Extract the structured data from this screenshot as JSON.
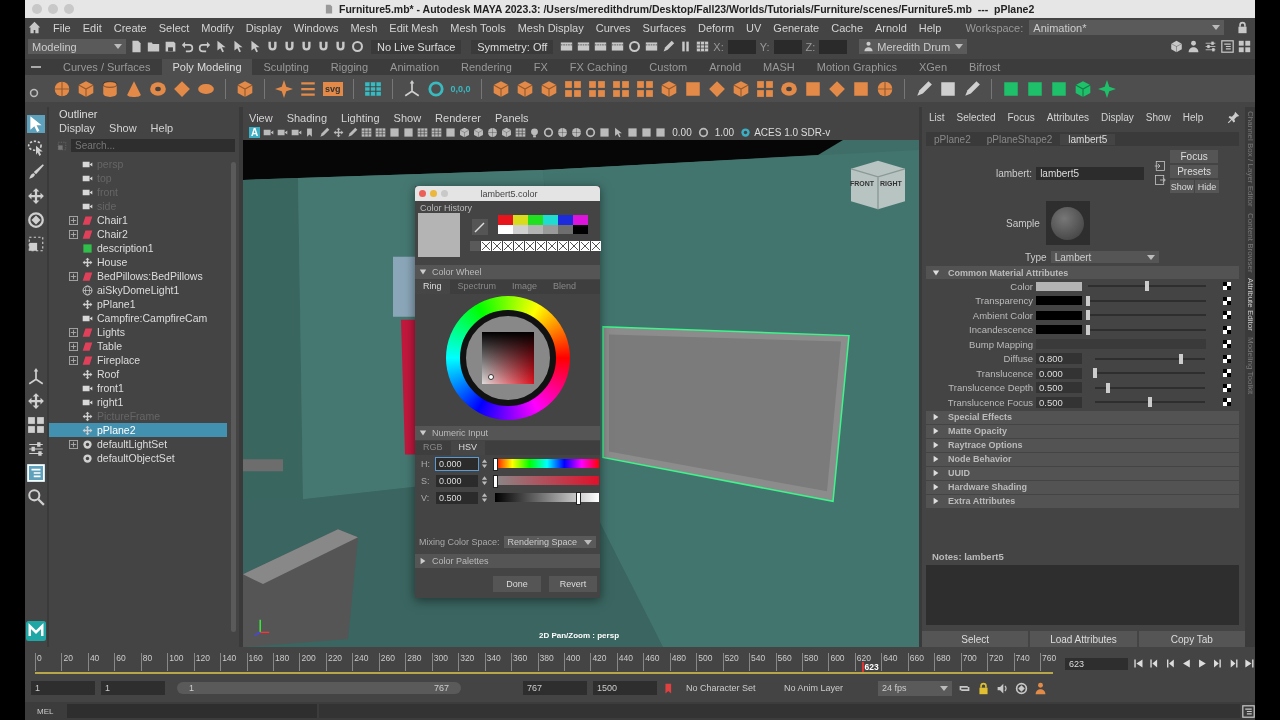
{
  "title_bar": {
    "title": "Furniture5.mb* - Autodesk MAYA 2023.3: /Users/meredithdrum/Desktop/Fall23/Worlds/Tutorials/Furniture/scenes/Furniture5.mb  ---  pPlane2"
  },
  "menu_bar": [
    "File",
    "Edit",
    "Create",
    "Select",
    "Modify",
    "Display",
    "Windows",
    "Mesh",
    "Edit Mesh",
    "Mesh Tools",
    "Mesh Display",
    "Curves",
    "Surfaces",
    "Deform",
    "UV",
    "Generate",
    "Cache",
    "Arnold",
    "Help"
  ],
  "workspace": {
    "label": "Workspace:",
    "value": "Animation*"
  },
  "status_line": {
    "mode": "Modeling",
    "live_surface": "No Live Surface",
    "symmetry": "Symmetry: Off",
    "x_label": "X:",
    "y_label": "Y:",
    "z_label": "Z:",
    "user": "Meredith Drum"
  },
  "shelf_tabs": [
    {
      "label": "Curves / Surfaces",
      "selected": false
    },
    {
      "label": "Poly Modeling",
      "selected": true
    },
    {
      "label": "Sculpting",
      "selected": false
    },
    {
      "label": "Rigging",
      "selected": false
    },
    {
      "label": "Animation",
      "selected": false
    },
    {
      "label": "Rendering",
      "selected": false
    },
    {
      "label": "FX",
      "selected": false
    },
    {
      "label": "FX Caching",
      "selected": false
    },
    {
      "label": "Custom",
      "selected": false
    },
    {
      "label": "Arnold",
      "selected": false
    },
    {
      "label": "MASH",
      "selected": false
    },
    {
      "label": "Motion Graphics",
      "selected": false
    },
    {
      "label": "XGen",
      "selected": false
    },
    {
      "label": "Bifrost",
      "selected": false
    }
  ],
  "shelf": {
    "svg_label": "svg",
    "origin_label": "0,0,0"
  },
  "outliner": {
    "title": "Outliner",
    "menu": [
      "Display",
      "Show",
      "Help"
    ],
    "search": {
      "placeholder": "Search..."
    },
    "items": [
      {
        "name": "persp",
        "kind": "camera",
        "expandable": false,
        "hidden": true,
        "selected": false
      },
      {
        "name": "top",
        "kind": "camera",
        "expandable": false,
        "hidden": true,
        "selected": false
      },
      {
        "name": "front",
        "kind": "camera",
        "expandable": false,
        "hidden": true,
        "selected": false
      },
      {
        "name": "side",
        "kind": "camera",
        "expandable": false,
        "hidden": true,
        "selected": false
      },
      {
        "name": "Chair1",
        "kind": "group",
        "expandable": true,
        "hidden": false,
        "selected": false
      },
      {
        "name": "Chair2",
        "kind": "group",
        "expandable": true,
        "hidden": false,
        "selected": false
      },
      {
        "name": "description1",
        "kind": "xgen",
        "expandable": false,
        "hidden": false,
        "selected": false
      },
      {
        "name": "House",
        "kind": "transform",
        "expandable": false,
        "hidden": false,
        "selected": false
      },
      {
        "name": "BedPillows:BedPillows",
        "kind": "group",
        "expandable": true,
        "hidden": false,
        "selected": false
      },
      {
        "name": "aiSkyDomeLight1",
        "kind": "light",
        "expandable": false,
        "hidden": false,
        "selected": false
      },
      {
        "name": "pPlane1",
        "kind": "transform",
        "expandable": false,
        "hidden": false,
        "selected": false
      },
      {
        "name": "Campfire:CampfireCam",
        "kind": "camera",
        "expandable": false,
        "hidden": false,
        "selected": false
      },
      {
        "name": "Lights",
        "kind": "group",
        "expandable": true,
        "hidden": false,
        "selected": false
      },
      {
        "name": "Table",
        "kind": "group",
        "expandable": true,
        "hidden": false,
        "selected": false
      },
      {
        "name": "Fireplace",
        "kind": "group",
        "expandable": true,
        "hidden": false,
        "selected": false
      },
      {
        "name": "Roof",
        "kind": "transform",
        "expandable": false,
        "hidden": false,
        "selected": false
      },
      {
        "name": "front1",
        "kind": "camera",
        "expandable": false,
        "hidden": false,
        "selected": false
      },
      {
        "name": "right1",
        "kind": "camera",
        "expandable": false,
        "hidden": false,
        "selected": false
      },
      {
        "name": "PictureFrame",
        "kind": "transform",
        "expandable": false,
        "hidden": true,
        "selected": false
      },
      {
        "name": "pPlane2",
        "kind": "transform",
        "expandable": false,
        "hidden": false,
        "selected": true
      },
      {
        "name": "defaultLightSet",
        "kind": "set",
        "expandable": true,
        "hidden": false,
        "selected": false
      },
      {
        "name": "defaultObjectSet",
        "kind": "set",
        "expandable": false,
        "hidden": false,
        "selected": false
      }
    ]
  },
  "viewport": {
    "menu": [
      "View",
      "Shading",
      "Lighting",
      "Show",
      "Renderer",
      "Panels"
    ],
    "text_button": "A",
    "exposure": "0.00",
    "gamma": "1.00",
    "color_space": "ACES 1.0 SDR-v",
    "cube_faces": [
      "FRONT",
      "RIGHT"
    ],
    "status": "2D Pan/Zoom : persp"
  },
  "color_editor": {
    "title": "lambert5.color",
    "history_label": "Color History",
    "current_swatch": {
      "color": "#b4b4b4"
    },
    "history": [
      {
        "color": "#e8141c"
      },
      {
        "color": "#d8dc1c"
      },
      {
        "color": "#20e020"
      },
      {
        "color": "#20dcd0"
      },
      {
        "color": "#1c2cdc"
      },
      {
        "color": "#dc14dc"
      },
      {
        "color": "#ffffff"
      },
      {
        "color": "#d0d0d0"
      },
      {
        "color": "#b4b4b4"
      },
      {
        "color": "#9a9a9a"
      },
      {
        "color": "#6e6e6e"
      },
      {
        "color": "#000000"
      }
    ],
    "recent": [
      {
        "empty": false,
        "color": "#5a5a5a"
      },
      {
        "empty": true
      },
      {
        "empty": true
      },
      {
        "empty": true
      },
      {
        "empty": true
      },
      {
        "empty": true
      },
      {
        "empty": true
      },
      {
        "empty": true
      },
      {
        "empty": true
      },
      {
        "empty": true
      },
      {
        "empty": true
      },
      {
        "empty": true
      }
    ],
    "wheel_section": {
      "label": "Color Wheel",
      "expanded": true
    },
    "wheel_tabs": [
      {
        "label": "Ring",
        "selected": true
      },
      {
        "label": "Spectrum",
        "selected": false
      },
      {
        "label": "Image",
        "selected": false
      },
      {
        "label": "Blend",
        "selected": false
      }
    ],
    "numeric_section": {
      "label": "Numeric Input",
      "expanded": true
    },
    "mode_tabs": [
      {
        "label": "RGB",
        "selected": false
      },
      {
        "label": "HSV",
        "selected": true
      }
    ],
    "fields": [
      {
        "label": "H:",
        "value": "0.000",
        "kind": "hue",
        "level": 0
      },
      {
        "label": "S:",
        "value": "0.000",
        "kind": "saturation",
        "level": 0
      },
      {
        "label": "V:",
        "value": "0.500",
        "kind": "value",
        "level": 0.8
      }
    ],
    "mixing_label": "Mixing Color Space:",
    "mixing_value": "Rendering Space",
    "palettes_section": {
      "label": "Color Palettes",
      "expanded": false
    },
    "buttons": [
      "Done",
      "Revert"
    ]
  },
  "attribute_editor": {
    "menu": [
      "List",
      "Selected",
      "Focus",
      "Attributes",
      "Display",
      "Show",
      "Help"
    ],
    "tabs": [
      {
        "label": "pPlane2",
        "selected": false
      },
      {
        "label": "pPlaneShape2",
        "selected": false
      },
      {
        "label": "lambert5",
        "selected": true
      }
    ],
    "name_label": "lambert:",
    "name_value": "lambert5",
    "focus_button": "Focus",
    "presets_button": "Presets",
    "show_button": "Show",
    "hide_button": "Hide",
    "sample_label": "Sample",
    "type_label": "Type",
    "type_value": "Lambert",
    "main_section": {
      "label": "Common Material Attributes",
      "expanded": true
    },
    "attributes": [
      {
        "label": "Color",
        "kind": "color",
        "color": "#b4b4b4",
        "level": 0.5
      },
      {
        "label": "Transparency",
        "kind": "color",
        "color": "#000000",
        "level": 0
      },
      {
        "label": "Ambient Color",
        "kind": "color",
        "color": "#000000",
        "level": 0
      },
      {
        "label": "Incandescence",
        "kind": "color",
        "color": "#000000",
        "level": 0
      },
      {
        "label": "Bump Mapping",
        "kind": "map"
      },
      {
        "label": "Diffuse",
        "kind": "number",
        "value": "0.800",
        "level": 0.78
      },
      {
        "label": "Translucence",
        "kind": "number",
        "value": "0.000",
        "level": 0
      },
      {
        "label": "Translucence Depth",
        "kind": "number",
        "value": "0.500",
        "level": 0.12
      },
      {
        "label": "Translucence Focus",
        "kind": "number",
        "value": "0.500",
        "level": 0.5
      }
    ],
    "sections": [
      {
        "label": "Special Effects",
        "expanded": false
      },
      {
        "label": "Matte Opacity",
        "expanded": false
      },
      {
        "label": "Raytrace Options",
        "expanded": false
      },
      {
        "label": "Node Behavior",
        "expanded": false
      },
      {
        "label": "UUID",
        "expanded": false
      },
      {
        "label": "Hardware Shading",
        "expanded": false
      },
      {
        "label": "Extra Attributes",
        "expanded": false
      }
    ],
    "notes_label": "Notes:  lambert5",
    "bottom_buttons": [
      "Select",
      "Load Attributes",
      "Copy Tab"
    ]
  },
  "side_tabs": [
    {
      "label": "Channel Box / Layer Editor",
      "selected": false
    },
    {
      "label": "Content Browser",
      "selected": false
    },
    {
      "label": "Attribute Editor",
      "selected": true
    },
    {
      "label": "Modeling Toolkit",
      "selected": false
    }
  ],
  "timeline": {
    "ticks": [
      "0",
      "20",
      "40",
      "60",
      "80",
      "100",
      "120",
      "140",
      "160",
      "180",
      "200",
      "220",
      "240",
      "260",
      "280",
      "300",
      "320",
      "340",
      "360",
      "380",
      "400",
      "420",
      "440",
      "460",
      "480",
      "500",
      "520",
      "540",
      "560",
      "580",
      "600",
      "620",
      "640",
      "660",
      "680",
      "700",
      "720",
      "740",
      "760"
    ],
    "playhead_label": "623",
    "level": 0.812,
    "current_frame": "623"
  },
  "range": {
    "start": "1",
    "playback_start": "1",
    "bar_start": "1",
    "bar_end": "767",
    "playback_end": "767",
    "end": "1500",
    "character_set": "No Character Set",
    "anim_layer": "No Anim Layer",
    "fps": "24 fps"
  },
  "command_line": {
    "label": "MEL"
  }
}
